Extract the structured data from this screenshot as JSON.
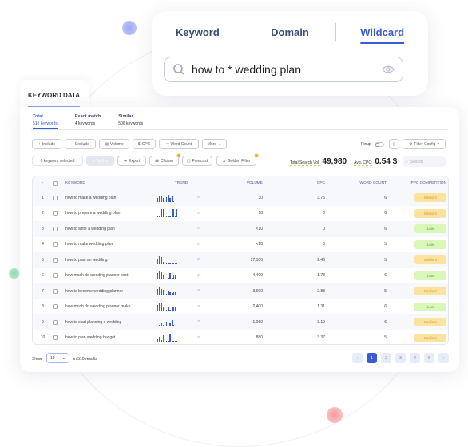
{
  "search": {
    "tabs": [
      "Keyword",
      "Domain",
      "Wildcard"
    ],
    "active_tab": "Wildcard",
    "query": "how to * wedding plan"
  },
  "panel": {
    "title": "KEYWORD DATA",
    "subtabs": [
      {
        "label": "Total",
        "count": "510 keywords"
      },
      {
        "label": "Exact match",
        "count": "4 keywords"
      },
      {
        "label": "Similar",
        "count": "506 keywords"
      }
    ],
    "filters": [
      "Include",
      "Exclude",
      "Volume",
      "CPC",
      "Word Count",
      "More"
    ],
    "pinup": "Pinup",
    "filter_config": "Filter Config",
    "selected": "0 keyword selected",
    "actions": [
      "Add to",
      "Export",
      "Cluster",
      "Forecast",
      "Golden Filter"
    ],
    "total_label": "Total Search Vol:",
    "total_value": "49,980",
    "avg_label": "Avg. CPC:",
    "avg_value": "0.54 $",
    "search_placeholder": "Search"
  },
  "table": {
    "columns": [
      "KEYWORD",
      "TREND",
      "VOLUME",
      "CPC",
      "WORD COUNT",
      "PPC COMPETITION"
    ],
    "rows": [
      {
        "n": "1",
        "keyword": "how to make a wedding plan",
        "trend": [
          5,
          8,
          8,
          5,
          4,
          6,
          9,
          5,
          7,
          1
        ],
        "volume": "30",
        "cpc": "3.75",
        "words": "6",
        "ppc": "Medium"
      },
      {
        "n": "2",
        "keyword": "how to prepare a wedding plan",
        "trend": [
          1,
          1,
          10,
          10,
          1,
          1,
          1,
          1,
          10,
          10,
          1,
          10
        ],
        "volume": "10",
        "cpc": "0",
        "words": "6",
        "ppc": "Medium"
      },
      {
        "n": "3",
        "keyword": "how to write a wedding plan",
        "trend": [],
        "volume": "<10",
        "cpc": "0",
        "words": "6",
        "ppc": "Low"
      },
      {
        "n": "4",
        "keyword": "how to make wedding plan",
        "trend": [],
        "volume": "<10",
        "cpc": "0",
        "words": "5",
        "ppc": "Low"
      },
      {
        "n": "5",
        "keyword": "how to plan an wedding",
        "trend": [
          7,
          10,
          9,
          3,
          1,
          1,
          1,
          1,
          1,
          1,
          1,
          1
        ],
        "volume": "27,100",
        "cpc": "2.46",
        "words": "5",
        "ppc": "Medium"
      },
      {
        "n": "6",
        "keyword": "how much do wedding planner cost",
        "trend": [
          8,
          10,
          9,
          5,
          4,
          1,
          2,
          8,
          2,
          5,
          5
        ],
        "volume": "4,400",
        "cpc": "1.73",
        "words": "6",
        "ppc": "Low"
      },
      {
        "n": "7",
        "keyword": "how to become wedding planner",
        "trend": [
          8,
          10,
          8,
          7,
          6,
          2,
          5,
          4,
          3,
          4,
          4
        ],
        "volume": "3,600",
        "cpc": "2.88",
        "words": "5",
        "ppc": "Medium"
      },
      {
        "n": "8",
        "keyword": "how much do wedding planner make",
        "trend": [
          7,
          10,
          9,
          5,
          5,
          1,
          4,
          1,
          5,
          5,
          5
        ],
        "volume": "2,400",
        "cpc": "1.31",
        "words": "6",
        "ppc": "Low"
      },
      {
        "n": "9",
        "keyword": "how to start planning a wedding",
        "trend": [
          1,
          2,
          4,
          2,
          2,
          5,
          1,
          4,
          8,
          2,
          1,
          1
        ],
        "volume": "1,080",
        "cpc": "3.19",
        "words": "6",
        "ppc": "Medium"
      },
      {
        "n": "10",
        "keyword": "how to plan wedding budget",
        "trend": [
          3,
          6,
          2,
          8,
          5,
          1,
          1,
          10,
          1,
          1,
          1,
          1
        ],
        "volume": "880",
        "cpc": "3.37",
        "words": "5",
        "ppc": "Medium"
      }
    ]
  },
  "pagination": {
    "show_label": "Show",
    "page_size": "10",
    "results": "in 510 results",
    "pages": [
      "1",
      "2",
      "3",
      "4",
      "5"
    ],
    "current": "1"
  },
  "colors": {
    "accent": "#3a5bd9",
    "medium": "#fde3a0",
    "low": "#d8f7b8"
  }
}
